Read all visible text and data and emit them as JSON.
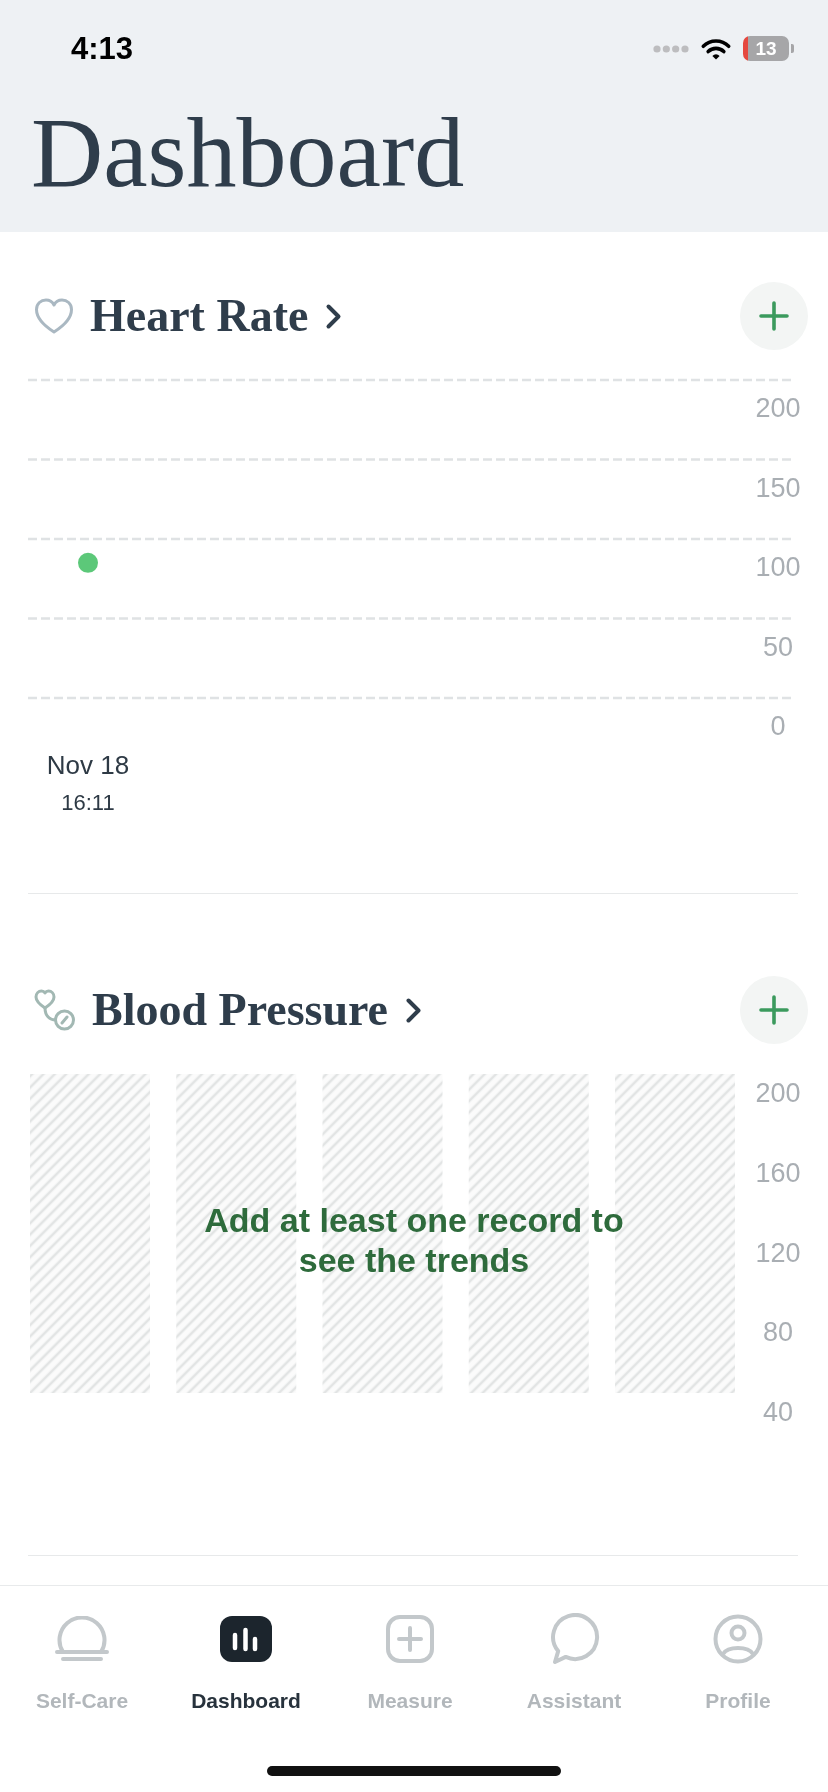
{
  "status_bar": {
    "time": "4:13",
    "battery": "13"
  },
  "header": {
    "title": "Dashboard"
  },
  "sections": [
    {
      "kind": "chart",
      "title": "Heart Rate",
      "category_times": [
        "16:11"
      ],
      "chart_data": {
        "type": "scatter",
        "categories": [
          "Nov 18"
        ],
        "values": [
          85
        ],
        "ylim": [
          0,
          200
        ],
        "yticks": [
          0,
          50,
          100,
          150,
          200
        ],
        "grid": true
      }
    },
    {
      "kind": "empty",
      "title": "Blood Pressure",
      "axis_labels": [
        "200",
        "160",
        "120",
        "80",
        "40"
      ],
      "empty_message": "Add at least one record to see the trends"
    }
  ],
  "tabs": [
    {
      "label": "Self-Care",
      "selected": false
    },
    {
      "label": "Dashboard",
      "selected": true
    },
    {
      "label": "Measure",
      "selected": false
    },
    {
      "label": "Assistant",
      "selected": false
    },
    {
      "label": "Profile",
      "selected": false
    }
  ]
}
